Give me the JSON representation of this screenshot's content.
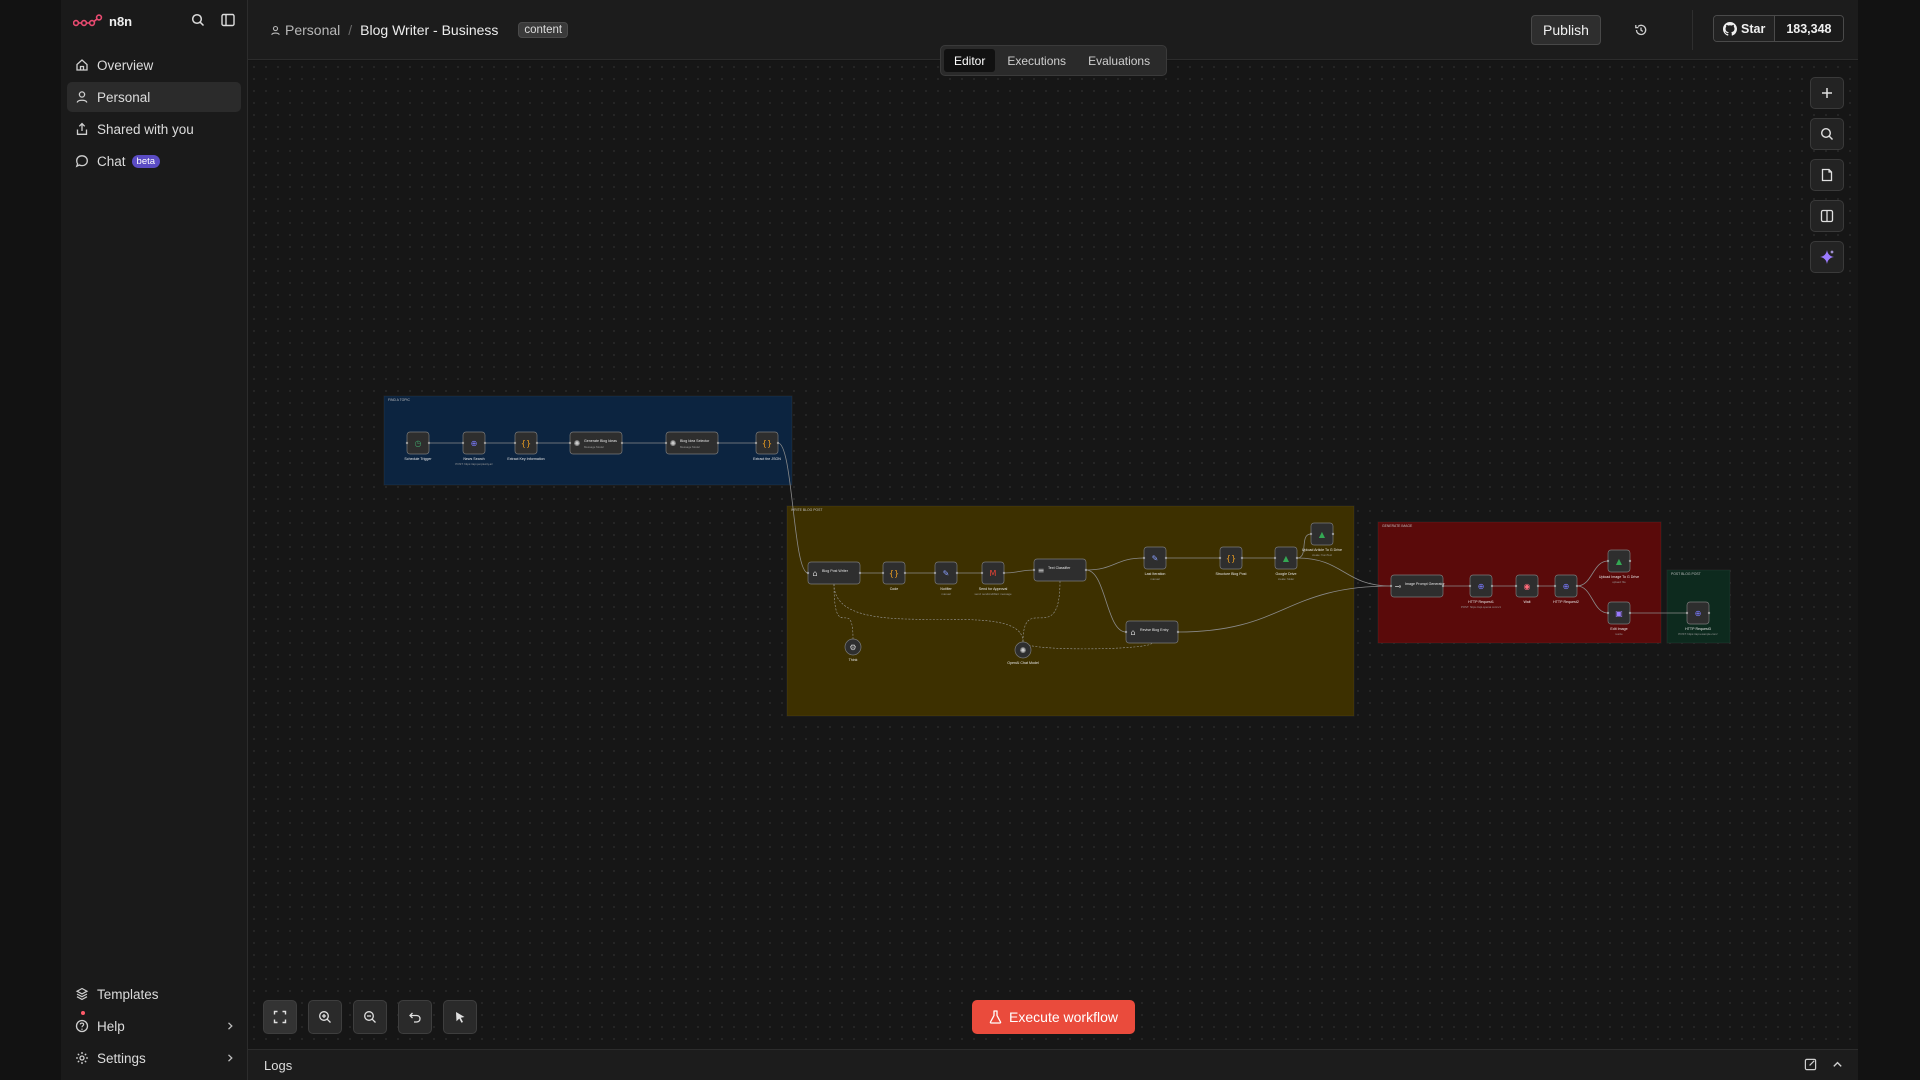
{
  "brand": {
    "name": "n8n"
  },
  "nav": [
    {
      "label": "Overview",
      "icon": "home-icon"
    },
    {
      "label": "Personal",
      "icon": "user-icon"
    },
    {
      "label": "Shared with you",
      "icon": "share-icon"
    },
    {
      "label": "Chat",
      "icon": "chat-icon",
      "badge": "beta"
    }
  ],
  "nav_bottom": [
    {
      "label": "Templates",
      "icon": "templates-icon"
    },
    {
      "label": "Help",
      "icon": "help-icon"
    },
    {
      "label": "Settings",
      "icon": "gear-icon"
    }
  ],
  "header": {
    "project": "Personal",
    "workflow_name": "Blog Writer - Business",
    "tag": "content",
    "publish_label": "Publish",
    "github_star_label": "Star",
    "github_star_count": "183,348"
  },
  "tabs": [
    {
      "label": "Editor",
      "active": true
    },
    {
      "label": "Executions",
      "active": false
    },
    {
      "label": "Evaluations",
      "active": false
    }
  ],
  "workflow": {
    "groups": [
      {
        "label": "FIND A TOPIC",
        "color": "#0c2440"
      },
      {
        "label": "WRITE BLOG POST",
        "color": "#3d3000"
      },
      {
        "label": "GENERATE IMAGE",
        "color": "#5a0a0a"
      },
      {
        "label": "POST BLOG POST",
        "color": "#0d2a1e"
      }
    ],
    "nodes": [
      {
        "id": "n1",
        "label": "Schedule Trigger",
        "sub": "",
        "icon": "clock-icon",
        "color": "#3fa36a"
      },
      {
        "id": "n2",
        "label": "News Search",
        "sub": "POST: https://api.perplexity.ai/",
        "icon": "globe-icon",
        "color": "#7a7aff"
      },
      {
        "id": "n3",
        "label": "Extract Key Information",
        "sub": "",
        "icon": "code-icon",
        "color": "#f0a020"
      },
      {
        "id": "n4",
        "label": "Generate Blog Ideas",
        "sub": "Message Model",
        "icon": "openai-icon",
        "color": "#cccccc"
      },
      {
        "id": "n5",
        "label": "Blog Idea Selector",
        "sub": "Message Model",
        "icon": "openai-icon",
        "color": "#cccccc"
      },
      {
        "id": "n6",
        "label": "Extract the JSON",
        "sub": "",
        "icon": "code-icon",
        "color": "#f0a020"
      },
      {
        "id": "n7",
        "label": "Blog Post Writer",
        "sub": "",
        "icon": "agent-icon",
        "color": "#cccccc"
      },
      {
        "id": "n8",
        "label": "Code",
        "sub": "",
        "icon": "code-icon",
        "color": "#f0a020"
      },
      {
        "id": "n9",
        "label": "Notifier",
        "sub": "manual",
        "icon": "pen-icon",
        "color": "#8aa0ff"
      },
      {
        "id": "n10",
        "label": "Send for Approval",
        "sub": "send: sendAndWait: message",
        "icon": "gmail-icon",
        "color": "#ea4335"
      },
      {
        "id": "n11",
        "label": "Text Classifier",
        "sub": "",
        "icon": "classifier-icon",
        "color": "#cccccc"
      },
      {
        "id": "n12",
        "label": "Last Iteration",
        "sub": "manual",
        "icon": "pen-icon",
        "color": "#8aa0ff"
      },
      {
        "id": "n13",
        "label": "Structure Blog Post",
        "sub": "",
        "icon": "code-icon",
        "color": "#f0a020"
      },
      {
        "id": "n14",
        "label": "Google Drive",
        "sub": "create: folder",
        "icon": "drive-icon",
        "color": "#34a853"
      },
      {
        "id": "n15",
        "label": "Upload Article To G Drive",
        "sub": "create: fromText",
        "icon": "drive-icon",
        "color": "#34a853"
      },
      {
        "id": "n16",
        "label": "Think",
        "sub": "",
        "icon": "tool-icon",
        "color": "#cccccc"
      },
      {
        "id": "n17",
        "label": "OpenAI Chat Model",
        "sub": "",
        "icon": "openai-icon",
        "color": "#cccccc"
      },
      {
        "id": "n18",
        "label": "Revise Blog Entry",
        "sub": "",
        "icon": "agent-icon",
        "color": "#cccccc"
      },
      {
        "id": "n19",
        "label": "Image Prompt Generator",
        "sub": "",
        "icon": "link-icon",
        "color": "#cccccc"
      },
      {
        "id": "n20",
        "label": "HTTP Request1",
        "sub": "POST: https://api.openai.com/v1",
        "icon": "globe-icon",
        "color": "#7a7aff"
      },
      {
        "id": "n21",
        "label": "Wait",
        "sub": "",
        "icon": "pause-icon",
        "color": "#ff6b7a"
      },
      {
        "id": "n22",
        "label": "HTTP Request2",
        "sub": "",
        "icon": "globe-icon",
        "color": "#7a7aff"
      },
      {
        "id": "n23",
        "label": "Upload Image To G Drive",
        "sub": "upload: file",
        "icon": "drive-icon",
        "color": "#34a853"
      },
      {
        "id": "n24",
        "label": "Edit Image",
        "sub": "resize",
        "icon": "image-icon",
        "color": "#9a7aff"
      },
      {
        "id": "n25",
        "label": "HTTP Request3",
        "sub": "POST: https://api.example.com/",
        "icon": "globe-icon",
        "color": "#7a7aff"
      }
    ]
  },
  "execute_label": "Execute workflow",
  "logs_label": "Logs"
}
